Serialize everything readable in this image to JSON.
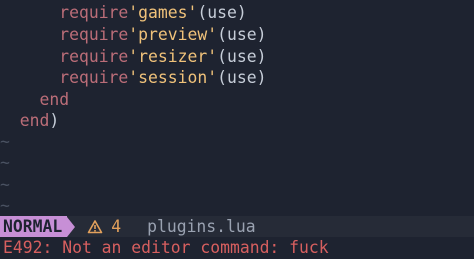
{
  "code_lines": [
    {
      "indent": "      ",
      "keyword": "require",
      "string": "'games'",
      "open": "(",
      "arg": "use",
      "close": ")"
    },
    {
      "indent": "      ",
      "keyword": "require",
      "string": "'preview'",
      "open": "(",
      "arg": "use",
      "close": ")"
    },
    {
      "indent": "      ",
      "keyword": "require",
      "string": "'resizer'",
      "open": "(",
      "arg": "use",
      "close": ")"
    },
    {
      "indent": "      ",
      "keyword": "require",
      "string": "'session'",
      "open": "(",
      "arg": "use",
      "close": ")"
    }
  ],
  "end_lines": [
    {
      "indent": "    ",
      "text": "end"
    },
    {
      "indent": "  ",
      "text": "end",
      "trailing": ")"
    }
  ],
  "tilde": "~",
  "statusline": {
    "mode": "NORMAL",
    "warning_count": "4",
    "filename": "plugins.lua"
  },
  "cmdline": {
    "message": "E492: Not an editor command: fuck"
  },
  "colors": {
    "background": "#1e2330",
    "keyword": "#bb6d78",
    "string": "#f0c27a",
    "mode_bg": "#c78fd6",
    "warning": "#e2a05c",
    "error": "#d75f5f"
  }
}
